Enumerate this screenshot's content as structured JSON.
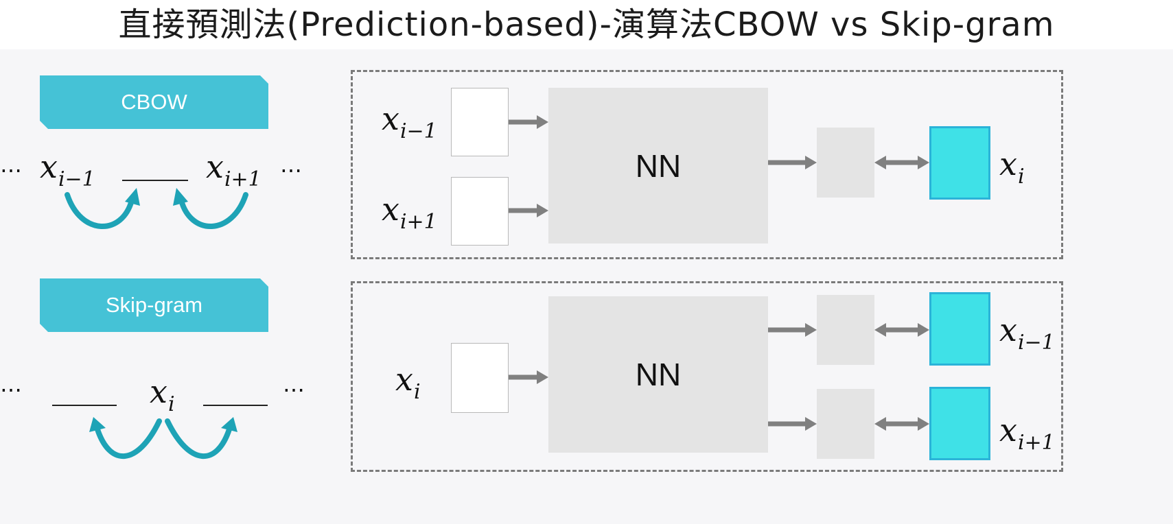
{
  "title": "直接預測法(Prediction-based)-演算法CBOW vs Skip-gram",
  "colors": {
    "tag": "#45c2d6",
    "arc": "#1ea3b6",
    "target_box": "#3fe1e7",
    "target_border": "#2bb3d8",
    "nn_box": "#e4e4e4",
    "arrow": "#808080",
    "frame": "#7a7a7a"
  },
  "cbow": {
    "tag_label": "CBOW",
    "left_dots": "…",
    "right_dots": "…",
    "ctx_prev": {
      "base": "x",
      "sub": "i−1"
    },
    "ctx_next": {
      "base": "x",
      "sub": "i+1"
    },
    "diagram": {
      "input_prev": {
        "base": "x",
        "sub": "i−1"
      },
      "input_next": {
        "base": "x",
        "sub": "i+1"
      },
      "nn_label": "NN",
      "output": {
        "base": "x",
        "sub": "i"
      }
    }
  },
  "skipgram": {
    "tag_label": "Skip-gram",
    "left_dots": "…",
    "right_dots": "…",
    "center": {
      "base": "x",
      "sub": "i"
    },
    "diagram": {
      "input": {
        "base": "x",
        "sub": "i"
      },
      "nn_label": "NN",
      "output_prev": {
        "base": "x",
        "sub": "i−1"
      },
      "output_next": {
        "base": "x",
        "sub": "i+1"
      }
    }
  }
}
